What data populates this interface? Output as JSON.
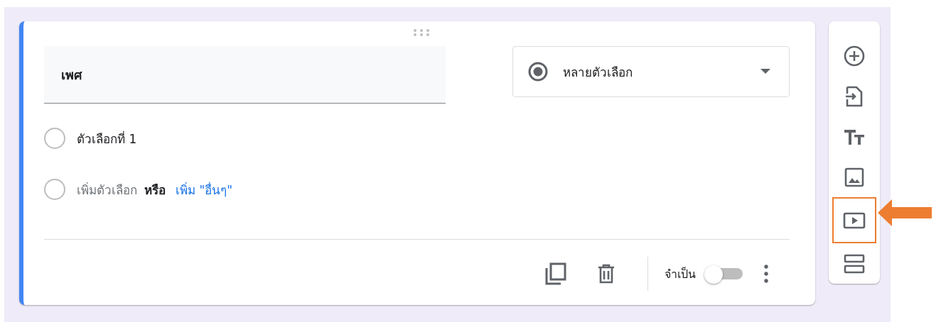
{
  "question": {
    "title": "เพศ",
    "type": {
      "label": "หลายตัวเลือก"
    },
    "options": [
      {
        "label": "ตัวเลือกที่ 1",
        "selected": false
      }
    ],
    "add_option": {
      "selected": false,
      "label": "เพิ่มตัวเลือก",
      "separator": "หรือ",
      "other_link": "เพิ่ม \"อื่นๆ\""
    },
    "required": {
      "label": "จำเป็น",
      "on": false
    }
  },
  "tools": [
    {
      "kind": "add",
      "highlighted": false
    },
    {
      "kind": "import",
      "highlighted": false
    },
    {
      "kind": "title",
      "highlighted": false
    },
    {
      "kind": "image",
      "highlighted": false
    },
    {
      "kind": "video",
      "highlighted": true
    },
    {
      "kind": "section",
      "highlighted": false
    }
  ]
}
